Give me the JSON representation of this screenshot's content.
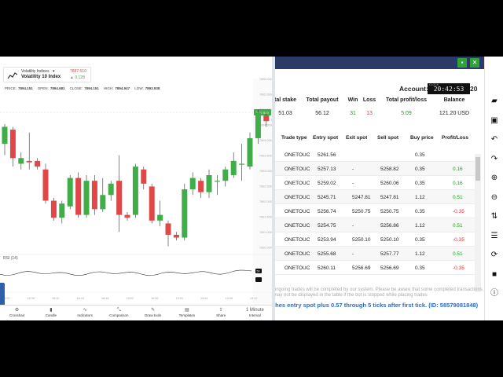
{
  "symbol": {
    "category": "Volatility Indices",
    "name": "Volatility 10 Index",
    "price": "7887.510",
    "change": "▲ 0.128"
  },
  "ohlc": [
    {
      "key": "PRICE:",
      "value": "7894.151"
    },
    {
      "key": "OPEN:",
      "value": "7894.681"
    },
    {
      "key": "CLOSE:",
      "value": "7894.151"
    },
    {
      "key": "HIGH:",
      "value": "7894.947"
    },
    {
      "key": "LOW:",
      "value": "7893.938"
    }
  ],
  "price_axis": [
    "7896.000",
    "7895.500",
    "7895.000",
    "7894.500",
    "7894.000",
    "7893.500",
    "7893.000",
    "7892.500",
    "7892.000",
    "7891.500",
    "7891.000",
    "7890.500"
  ],
  "price_badge": "7887.510",
  "rsi_label": "RSI (14)",
  "rsi_badge": "50",
  "time_axis": [
    "18:32",
    "18:36",
    "18:40",
    "18:44",
    "18:48",
    "18:52",
    "18:56",
    "19:00",
    "19:04",
    "19:08",
    "19:12"
  ],
  "candles": [
    {
      "o": 7893.9,
      "c": 7894.5,
      "h": 7894.6,
      "l": 7893.5
    },
    {
      "o": 7894.4,
      "c": 7893.4,
      "h": 7894.5,
      "l": 7893.1
    },
    {
      "o": 7893.2,
      "c": 7893.4,
      "h": 7893.6,
      "l": 7893.0
    },
    {
      "o": 7893.3,
      "c": 7893.25,
      "h": 7894.3,
      "l": 7893.0
    },
    {
      "o": 7893.3,
      "c": 7893.1,
      "h": 7893.4,
      "l": 7893.0
    },
    {
      "o": 7893.0,
      "c": 7891.9,
      "h": 7893.2,
      "l": 7891.8
    },
    {
      "o": 7891.9,
      "c": 7891.3,
      "h": 7892.0,
      "l": 7891.2
    },
    {
      "o": 7891.3,
      "c": 7891.8,
      "h": 7891.9,
      "l": 7891.1
    },
    {
      "o": 7891.7,
      "c": 7892.7,
      "h": 7892.8,
      "l": 7891.6
    },
    {
      "o": 7892.7,
      "c": 7891.4,
      "h": 7892.9,
      "l": 7891.3
    },
    {
      "o": 7891.4,
      "c": 7892.6,
      "h": 7892.8,
      "l": 7891.3
    },
    {
      "o": 7892.6,
      "c": 7891.6,
      "h": 7892.8,
      "l": 7891.4
    },
    {
      "o": 7891.6,
      "c": 7892.1,
      "h": 7892.7,
      "l": 7891.5
    },
    {
      "o": 7892.1,
      "c": 7892.5,
      "h": 7892.6,
      "l": 7891.9
    },
    {
      "o": 7892.6,
      "c": 7891.4,
      "h": 7893.5,
      "l": 7890.8
    },
    {
      "o": 7891.4,
      "c": 7891.3,
      "h": 7891.5,
      "l": 7891.2
    },
    {
      "o": 7891.4,
      "c": 7893.1,
      "h": 7893.2,
      "l": 7891.3
    },
    {
      "o": 7893.0,
      "c": 7892.5,
      "h": 7893.1,
      "l": 7892.3
    },
    {
      "o": 7892.4,
      "c": 7891.2,
      "h": 7892.5,
      "l": 7891.1
    },
    {
      "o": 7891.2,
      "c": 7891.4,
      "h": 7891.9,
      "l": 7891.0
    },
    {
      "o": 7891.1,
      "c": 7890.7,
      "h": 7891.2,
      "l": 7890.3
    },
    {
      "o": 7890.7,
      "c": 7890.6,
      "h": 7890.8,
      "l": 7890.5
    },
    {
      "o": 7890.6,
      "c": 7892.3,
      "h": 7892.5,
      "l": 7890.5
    },
    {
      "o": 7892.3,
      "c": 7892.7,
      "h": 7892.9,
      "l": 7892.1
    },
    {
      "o": 7892.6,
      "c": 7892.2,
      "h": 7892.7,
      "l": 7892.0
    },
    {
      "o": 7892.2,
      "c": 7892.8,
      "h": 7893.0,
      "l": 7892.0
    },
    {
      "o": 7892.6,
      "c": 7892.6,
      "h": 7892.8,
      "l": 7892.1
    },
    {
      "o": 7892.6,
      "c": 7893.0,
      "h": 7893.1,
      "l": 7892.4
    },
    {
      "o": 7892.8,
      "c": 7893.3,
      "h": 7893.6,
      "l": 7892.7
    },
    {
      "o": 7893.2,
      "c": 7893.2,
      "h": 7893.9,
      "l": 7892.6
    },
    {
      "o": 7893.1,
      "c": 7894.1,
      "h": 7894.3,
      "l": 7893.0
    },
    {
      "o": 7894.1,
      "c": 7895.0,
      "h": 7895.1,
      "l": 7893.9
    },
    {
      "o": 7894.9,
      "c": 7894.7,
      "h": 7895.0,
      "l": 7894.5
    },
    {
      "o": 7894.7,
      "c": 7894.8,
      "h": 7895.1,
      "l": 7894.4
    }
  ],
  "toolbar": [
    {
      "icon": "⚙",
      "label": "Crosshair"
    },
    {
      "icon": "▮",
      "label": "Candle"
    },
    {
      "icon": "∿",
      "label": "Indicators"
    },
    {
      "icon": "⤡",
      "label": "Comparison"
    },
    {
      "icon": "✎",
      "label": "Draw tools"
    },
    {
      "icon": "▤",
      "label": "Templates"
    },
    {
      "icon": "⇪",
      "label": "Share"
    },
    {
      "icon": "1 Minute",
      "label": "Interval"
    }
  ],
  "account": {
    "label": "Account:",
    "clock_caption": "CLOCK",
    "clock": "20:42:53",
    "tail": "20"
  },
  "summary": {
    "headers": [
      "tal stake",
      "Total payout",
      "Win",
      "Loss",
      "Total profit/loss",
      "Balance"
    ],
    "values": [
      "51.03",
      "56.12",
      "31",
      "13",
      "5.09",
      "121.20 USD"
    ]
  },
  "transactions": {
    "headers": [
      "Trade type",
      "Entry spot",
      "Exit spot",
      "Sell spot",
      "Buy price",
      "Profit/Loss"
    ],
    "rows": [
      {
        "type": "ONETOUC",
        "entry": "5261.56",
        "exit": "",
        "sell": "",
        "buy": "0.35",
        "pl": "",
        "pl_sign": ""
      },
      {
        "type": "ONETOUC",
        "entry": "5257.13",
        "exit": "-",
        "sell": "5258.82",
        "buy": "0.35",
        "pl": "0.16",
        "pl_sign": "pos"
      },
      {
        "type": "ONETOUC",
        "entry": "5259.02",
        "exit": "-",
        "sell": "5260.06",
        "buy": "0.35",
        "pl": "0.16",
        "pl_sign": "pos"
      },
      {
        "type": "ONETOUC",
        "entry": "5245.71",
        "exit": "5247.81",
        "sell": "5247.81",
        "buy": "1.12",
        "pl": "0.51",
        "pl_sign": "pos"
      },
      {
        "type": "ONETOUC",
        "entry": "5256.74",
        "exit": "5250.75",
        "sell": "5250.75",
        "buy": "0.35",
        "pl": "-0.35",
        "pl_sign": "neg"
      },
      {
        "type": "ONETOUC",
        "entry": "5254.75",
        "exit": "-",
        "sell": "5256.86",
        "buy": "1.12",
        "pl": "0.51",
        "pl_sign": "pos"
      },
      {
        "type": "ONETOUC",
        "entry": "5253.94",
        "exit": "5250.10",
        "sell": "5250.10",
        "buy": "0.35",
        "pl": "-0.35",
        "pl_sign": "neg"
      },
      {
        "type": "ONETOUC",
        "entry": "5255.68",
        "exit": "-",
        "sell": "5257.77",
        "buy": "1.12",
        "pl": "0.51",
        "pl_sign": "pos"
      },
      {
        "type": "ONETOUC",
        "entry": "5260.11",
        "exit": "5256.69",
        "sell": "5256.69",
        "buy": "0.35",
        "pl": "-0.35",
        "pl_sign": "neg"
      }
    ]
  },
  "notice": "ongoing trades will be completed by our system. Please be aware that some completed transactions may not be displayed in the table if the bot is stopped while placing trades",
  "footer_text": "ches entry spot plus 0.57 through 5 ticks after first tick. (ID: 58579081848)",
  "right_toolbar": [
    {
      "icon": "▰",
      "name": "open-folder-icon"
    },
    {
      "icon": "▣",
      "name": "save-icon"
    },
    {
      "icon": "↶",
      "name": "undo-icon"
    },
    {
      "icon": "↷",
      "name": "redo-icon"
    },
    {
      "icon": "⊕",
      "name": "zoom-in-icon"
    },
    {
      "icon": "⊖",
      "name": "zoom-out-icon"
    },
    {
      "icon": "⇅",
      "name": "sort-icon"
    },
    {
      "icon": "☰",
      "name": "list-icon"
    },
    {
      "icon": "⟳",
      "name": "reload-icon"
    },
    {
      "icon": "■",
      "name": "stop-icon"
    },
    {
      "icon": "ⓘ",
      "name": "info-icon"
    }
  ],
  "colors": {
    "bull": "#3fae49",
    "bear": "#e04848",
    "titlebar": "#2b3a67",
    "accent_green": "#2fa33a",
    "footer_blue": "#2b6cc4"
  }
}
